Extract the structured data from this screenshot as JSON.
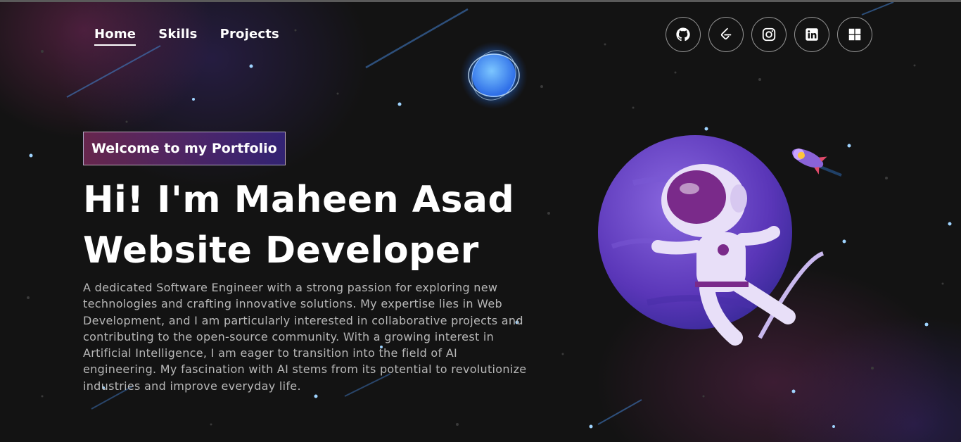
{
  "nav": {
    "links": [
      {
        "label": "Home",
        "active": true
      },
      {
        "label": "Skills",
        "active": false
      },
      {
        "label": "Projects",
        "active": false
      }
    ]
  },
  "socials": [
    {
      "icon": "github-icon"
    },
    {
      "icon": "leetcode-icon"
    },
    {
      "icon": "instagram-icon"
    },
    {
      "icon": "linkedin-icon"
    },
    {
      "icon": "windows-icon"
    }
  ],
  "hero": {
    "tagline": "Welcome to my Portfolio",
    "greeting": "Hi! I'm Maheen Asad",
    "role": "Website Developer",
    "description": "A dedicated Software Engineer with a strong passion for exploring new technologies and crafting innovative solutions. My expertise lies in Web Development, and I am particularly interested in collaborative projects and contributing to the open-source community. With a growing interest in Artificial Intelligence, I am eager to transition into the field of AI engineering. My fascination with AI stems from its potential to revolutionize industries and improve everyday life."
  },
  "colors": {
    "background": "#131313",
    "tagline_gradient_start": "#aa367c",
    "tagline_gradient_end": "#4a2fbd",
    "planet": "#6a45c9",
    "text_muted": "#b8b8b8"
  }
}
